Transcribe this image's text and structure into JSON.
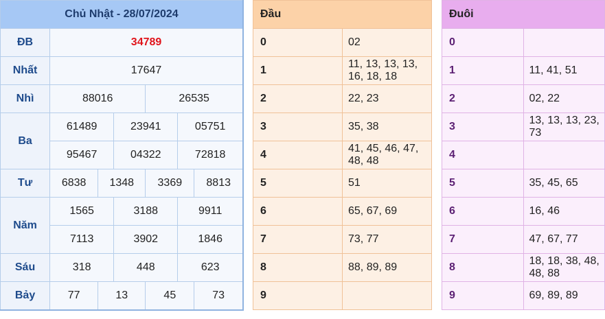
{
  "results": {
    "title": "Chủ Nhật - 28/07/2024",
    "prizes": [
      {
        "label": "ĐB",
        "numbers": [
          "34789"
        ]
      },
      {
        "label": "Nhất",
        "numbers": [
          "17647"
        ]
      },
      {
        "label": "Nhì",
        "numbers": [
          "88016",
          "26535"
        ]
      },
      {
        "label": "Ba",
        "numbers": [
          "61489",
          "23941",
          "05751",
          "95467",
          "04322",
          "72818"
        ]
      },
      {
        "label": "Tư",
        "numbers": [
          "6838",
          "1348",
          "3369",
          "8813"
        ]
      },
      {
        "label": "Năm",
        "numbers": [
          "1565",
          "3188",
          "9911",
          "7113",
          "3902",
          "1846"
        ]
      },
      {
        "label": "Sáu",
        "numbers": [
          "318",
          "448",
          "623"
        ]
      },
      {
        "label": "Bảy",
        "numbers": [
          "77",
          "13",
          "45",
          "73"
        ]
      }
    ]
  },
  "head": {
    "title": "Đầu",
    "rows": [
      {
        "digit": "0",
        "values": "02"
      },
      {
        "digit": "1",
        "values": "11, 13, 13, 13, 16, 18, 18"
      },
      {
        "digit": "2",
        "values": "22, 23"
      },
      {
        "digit": "3",
        "values": "35, 38"
      },
      {
        "digit": "4",
        "values": "41, 45, 46, 47, 48, 48"
      },
      {
        "digit": "5",
        "values": "51"
      },
      {
        "digit": "6",
        "values": "65, 67, 69"
      },
      {
        "digit": "7",
        "values": "73, 77"
      },
      {
        "digit": "8",
        "values": "88, 89, 89"
      },
      {
        "digit": "9",
        "values": ""
      }
    ]
  },
  "tail": {
    "title": "Đuôi",
    "rows": [
      {
        "digit": "0",
        "values": ""
      },
      {
        "digit": "1",
        "values": "11, 41, 51"
      },
      {
        "digit": "2",
        "values": "02, 22"
      },
      {
        "digit": "3",
        "values": "13, 13, 13, 23, 73"
      },
      {
        "digit": "4",
        "values": ""
      },
      {
        "digit": "5",
        "values": "35, 45, 65"
      },
      {
        "digit": "6",
        "values": "16, 46"
      },
      {
        "digit": "7",
        "values": "47, 67, 77"
      },
      {
        "digit": "8",
        "values": "18, 18, 38, 48, 48, 88"
      },
      {
        "digit": "9",
        "values": "69, 89, 89"
      }
    ]
  }
}
